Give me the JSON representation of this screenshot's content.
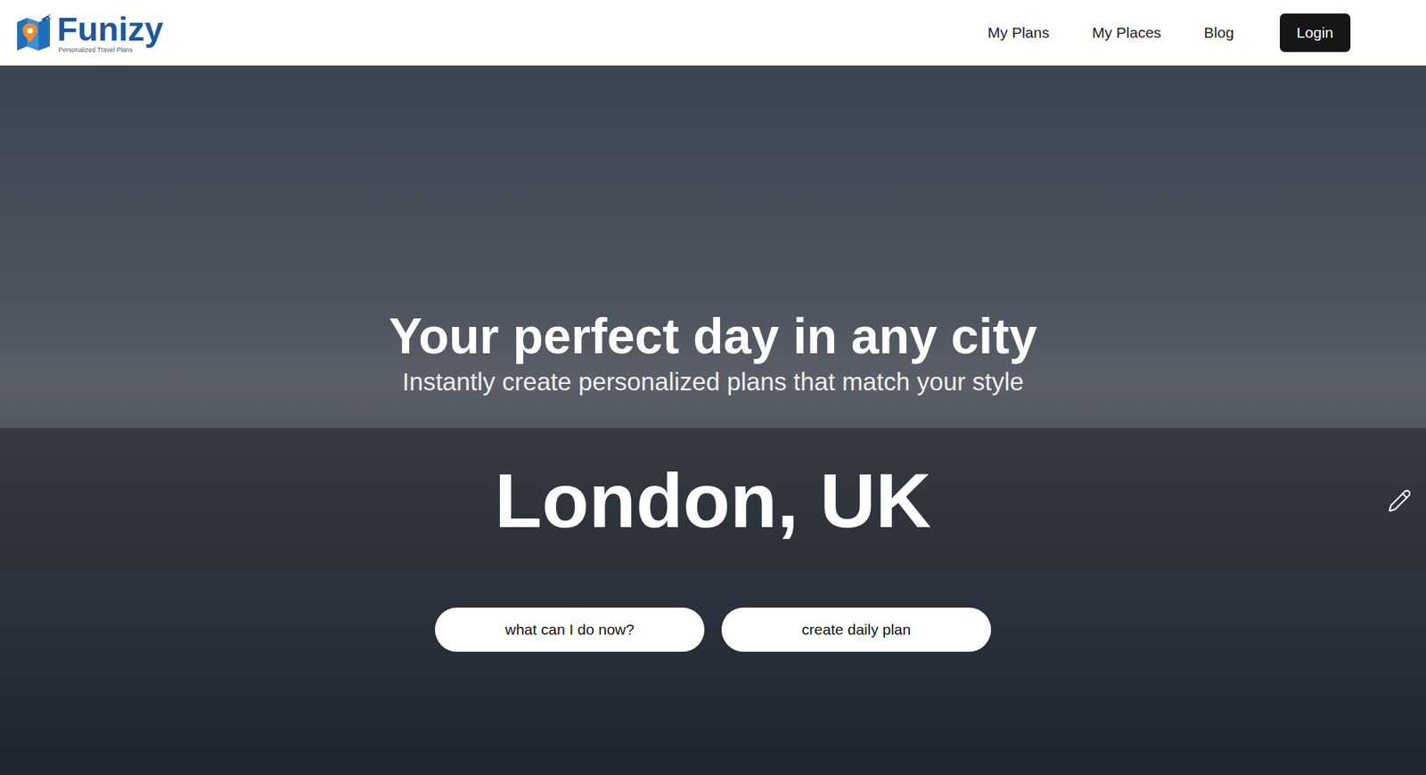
{
  "header": {
    "logo": {
      "name": "Funizy",
      "tagline": "Personalized Travel Plans"
    },
    "nav": [
      "My Plans",
      "My Places",
      "Blog"
    ],
    "login": "Login"
  },
  "hero": {
    "title": "Your perfect day in any city",
    "subtitle": "Instantly create personalized plans that match your style",
    "city": "London, UK",
    "actions": [
      "what can I do now?",
      "create daily plan"
    ]
  }
}
